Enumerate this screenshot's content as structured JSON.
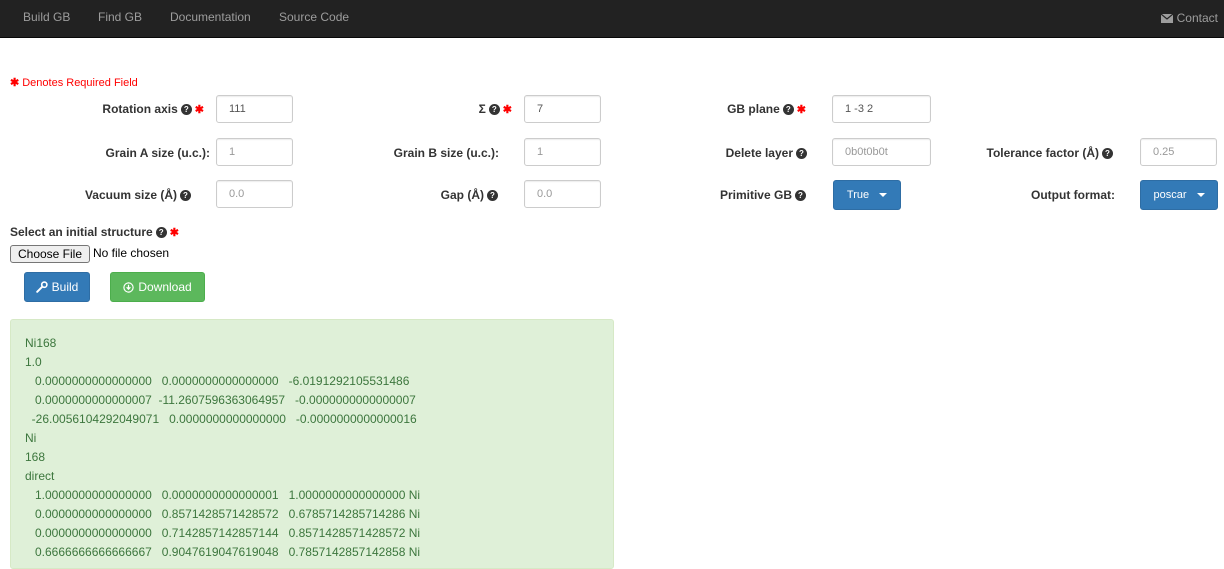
{
  "navbar": {
    "items": [
      "Build GB",
      "Find GB",
      "Documentation",
      "Source Code"
    ],
    "contact": "Contact"
  },
  "required_note": "Denotes Required Field",
  "form": {
    "rotation_axis": {
      "label": "Rotation axis",
      "value": "111"
    },
    "sigma": {
      "label": "Σ",
      "value": "7"
    },
    "gb_plane": {
      "label": "GB plane",
      "value": "1 -3 2"
    },
    "grain_a": {
      "label": "Grain A size (u.c.):",
      "placeholder": "1"
    },
    "grain_b": {
      "label": "Grain B size (u.c.):",
      "placeholder": "1"
    },
    "delete_layer": {
      "label": "Delete layer",
      "placeholder": "0b0t0b0t"
    },
    "tolerance": {
      "label": "Tolerance factor (Å)",
      "placeholder": "0.25"
    },
    "vacuum": {
      "label": "Vacuum size (Å)",
      "placeholder": "0.0"
    },
    "gap": {
      "label": "Gap (Å)",
      "placeholder": "0.0"
    },
    "primitive_gb": {
      "label": "Primitive GB",
      "selected": "True"
    },
    "output_format": {
      "label": "Output format:",
      "selected": "poscar"
    },
    "structure": {
      "label": "Select an initial structure",
      "choose_file": "Choose File",
      "file_status": "No file chosen"
    }
  },
  "buttons": {
    "build": "Build",
    "download": "Download"
  },
  "output": {
    "lines": [
      "Ni168",
      "1.0",
      "   0.0000000000000000   0.0000000000000000   -6.0191292105531486",
      "   0.0000000000000007  -11.2607596363064957   -0.0000000000000007",
      "  -26.0056104292049071   0.0000000000000000   -0.0000000000000016",
      "Ni",
      "168",
      "direct",
      "   1.0000000000000000   0.0000000000000001   1.0000000000000000 Ni",
      "   0.0000000000000000   0.8571428571428572   0.6785714285714286 Ni",
      "   0.0000000000000000   0.7142857142857144   0.8571428571428572 Ni",
      "   0.6666666666666667   0.9047619047619048   0.7857142857142858 Ni"
    ]
  },
  "colors": {
    "navbar_bg": "#222222",
    "nav_text": "#9d9d9d",
    "primary": "#337ab7",
    "success": "#5cb85c",
    "output_bg": "#dff0d8",
    "output_text": "#3c763d",
    "required": "#ff0000"
  }
}
